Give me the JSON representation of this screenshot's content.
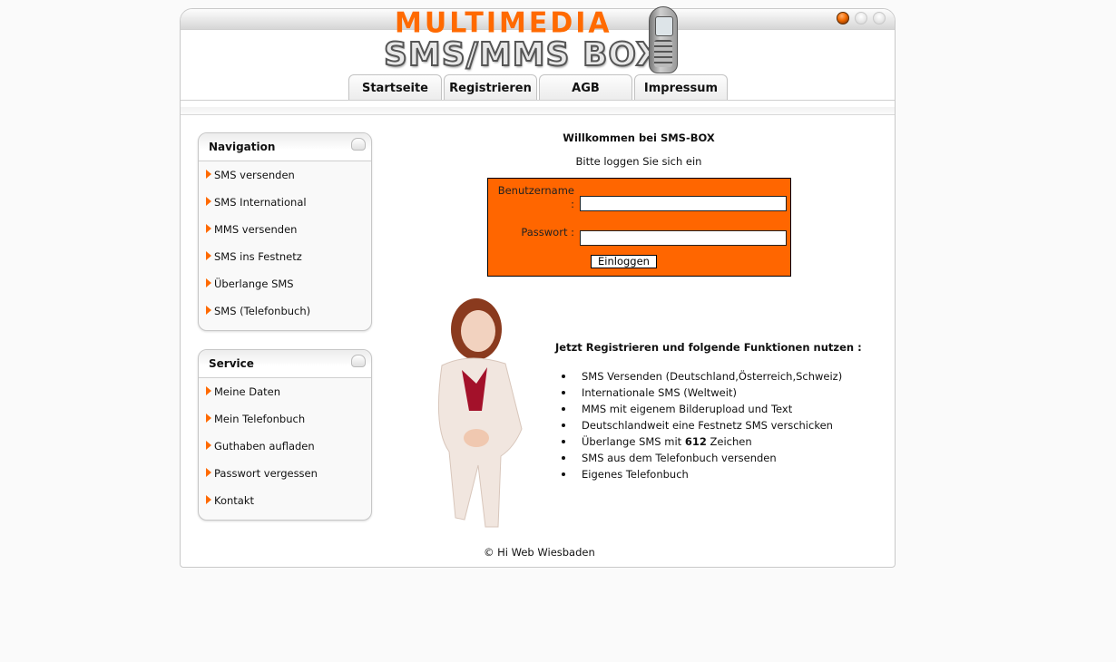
{
  "header": {
    "logo_top": "MULTIMEDIA",
    "logo_bottom": "SMS/MMS BOX",
    "window_buttons": [
      "window-button-active",
      "window-button",
      "window-button"
    ]
  },
  "tabs": [
    {
      "label": "Startseite"
    },
    {
      "label": "Registrieren"
    },
    {
      "label": "AGB"
    },
    {
      "label": "Impressum"
    }
  ],
  "sidebar": {
    "navigation": {
      "title": "Navigation",
      "items": [
        {
          "label": "SMS versenden"
        },
        {
          "label": "SMS International"
        },
        {
          "label": "MMS versenden"
        },
        {
          "label": "SMS ins Festnetz"
        },
        {
          "label": "Überlange SMS"
        },
        {
          "label": "SMS (Telefonbuch)"
        }
      ]
    },
    "service": {
      "title": "Service",
      "items": [
        {
          "label": "Meine Daten"
        },
        {
          "label": "Mein Telefonbuch"
        },
        {
          "label": "Guthaben aufladen"
        },
        {
          "label": "Passwort vergessen"
        },
        {
          "label": "Kontakt"
        }
      ]
    }
  },
  "main": {
    "welcome": "Willkommen bei SMS-BOX",
    "subtitle": "Bitte loggen Sie sich ein",
    "login": {
      "username_label": "Benutzername",
      "username_colon": ":",
      "username_value": "",
      "password_label": "Passwort :",
      "password_value": "",
      "submit_label": "Einloggen",
      "box_color": "#ff6600"
    },
    "register_title": "Jetzt Registrieren und folgende Funktionen nutzen :",
    "features": [
      {
        "text": "SMS Versenden (Deutschland,Österreich,Schweiz)"
      },
      {
        "pre": "Überlange SMS mit ",
        "bold": "612",
        "post": " Zeichen"
      },
      {
        "text": "Internationale SMS (Weltweit)"
      },
      {
        "text": "MMS mit eigenem Bilderupload und Text"
      },
      {
        "text": "Deutschlandweit eine Festnetz SMS verschicken"
      },
      {
        "text": "SMS aus dem Telefonbuch versenden"
      },
      {
        "text": "Eigenes Telefonbuch"
      }
    ]
  },
  "footer": {
    "text": "© Hi Web Wiesbaden"
  },
  "colors": {
    "accent": "#ff6600",
    "background": "#fafafa"
  }
}
